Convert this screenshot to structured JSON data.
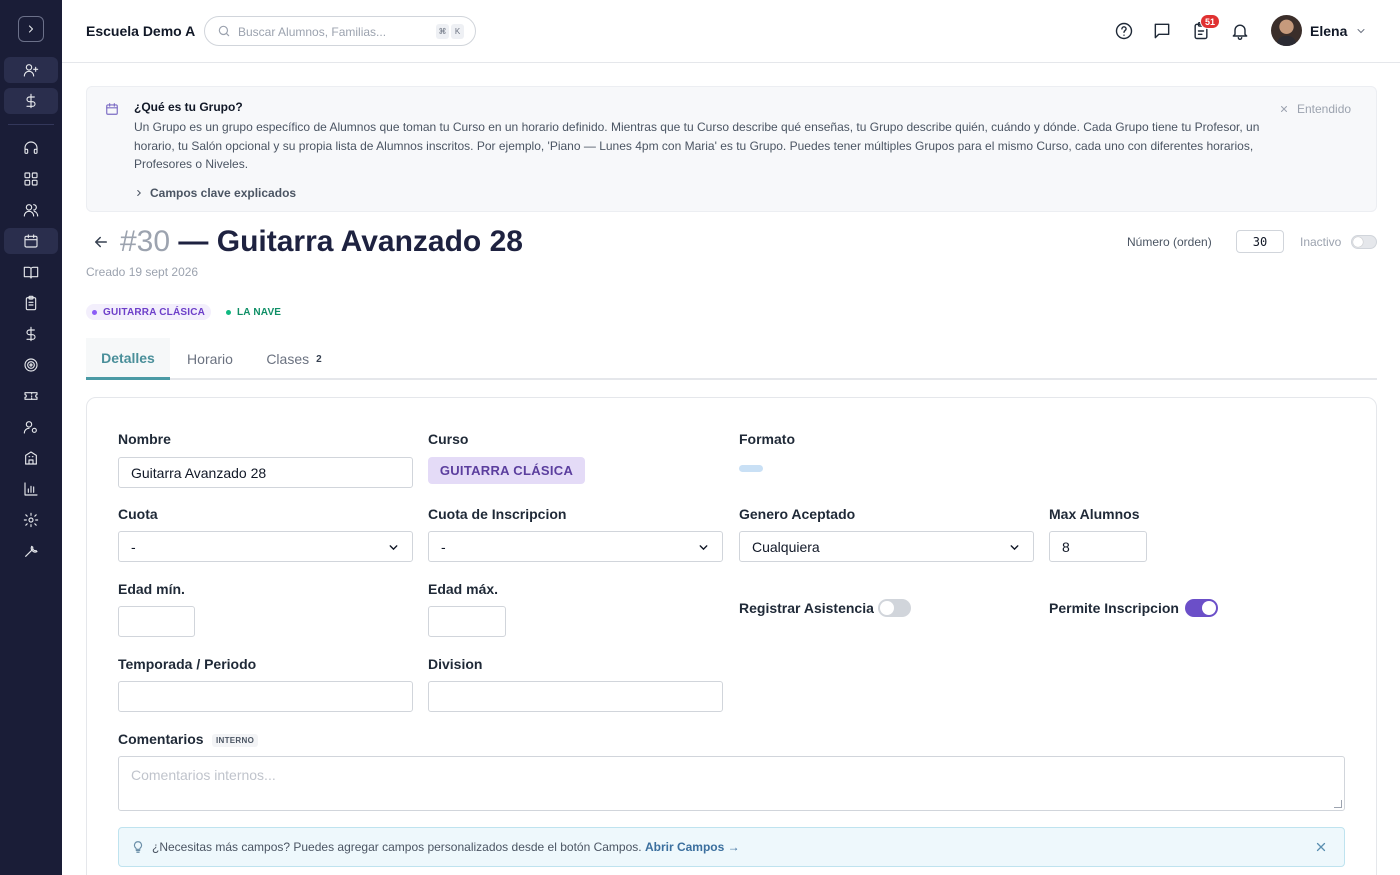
{
  "header": {
    "school_name": "Escuela Demo A",
    "search_placeholder": "Buscar Alumnos, Familias...",
    "search_kbd": [
      "⌘",
      "K"
    ],
    "notification_count": "51",
    "user_name": "Elena"
  },
  "sidebar": {
    "items": [
      {
        "icon": "user-plus-icon"
      },
      {
        "icon": "dollar-icon"
      },
      {
        "icon": "headset-icon"
      },
      {
        "icon": "grid-icon"
      },
      {
        "icon": "users-icon"
      },
      {
        "icon": "calendar-icon"
      },
      {
        "icon": "book-icon"
      },
      {
        "icon": "clipboard-icon"
      },
      {
        "icon": "dollar-icon"
      },
      {
        "icon": "target-icon"
      },
      {
        "icon": "ticket-icon"
      },
      {
        "icon": "user-settings-icon"
      },
      {
        "icon": "building-icon"
      },
      {
        "icon": "chart-icon"
      },
      {
        "icon": "gear-icon"
      },
      {
        "icon": "wrench-icon"
      }
    ]
  },
  "banner": {
    "title": "¿Qué es tu Grupo?",
    "text": "Un Grupo es un grupo específico de Alumnos que toman tu Curso en un horario definido. Mientras que tu Curso describe qué enseñas, tu Grupo describe quién, cuándo y dónde. Cada Grupo tiene tu Profesor, un horario, tu Salón opcional y su propia lista de Alumnos inscritos. Por ejemplo, 'Piano — Lunes 4pm con Maria' es tu Grupo. Puedes tener múltiples Grupos para el mismo Curso, cada uno con diferentes horarios, Profesores o Niveles.",
    "more_label": "Campos clave explicados",
    "dismiss_label": "Entendido"
  },
  "group": {
    "number": "#30",
    "title": "— Guitarra Avanzado 28",
    "created": "Creado 19 sept 2026",
    "order_label": "Número (orden)",
    "order_value": "30",
    "inactive_label": "Inactivo",
    "tags": [
      {
        "label": "GUITARRA CLÁSICA",
        "color": "#7c3aed"
      },
      {
        "label": "LA NAVE",
        "color": "#0f9f6e"
      }
    ]
  },
  "tabs": [
    {
      "label": "Detalles",
      "active": true
    },
    {
      "label": "Horario"
    },
    {
      "label": "Clases",
      "count": "2"
    }
  ],
  "form": {
    "nombre": {
      "label": "Nombre",
      "value": "Guitarra Avanzado 28"
    },
    "curso": {
      "label": "Curso",
      "value": "GUITARRA CLÁSICA"
    },
    "formato": {
      "label": "Formato"
    },
    "cuota": {
      "label": "Cuota",
      "value": "-"
    },
    "cuota_inscripcion": {
      "label": "Cuota de Inscripcion",
      "value": "-"
    },
    "genero": {
      "label": "Genero Aceptado",
      "value": "Cualquiera"
    },
    "max_alumnos": {
      "label": "Max Alumnos",
      "value": "8"
    },
    "edad_min": {
      "label": "Edad mín.",
      "value": ""
    },
    "edad_max": {
      "label": "Edad máx.",
      "value": ""
    },
    "registrar_asistencia": {
      "label": "Registrar Asistencia",
      "on": false
    },
    "permite_inscripcion": {
      "label": "Permite Inscripcion",
      "on": true
    },
    "temporada": {
      "label": "Temporada / Periodo",
      "value": ""
    },
    "division": {
      "label": "Division",
      "value": ""
    },
    "comentarios": {
      "label": "Comentarios",
      "badge": "INTERNO",
      "placeholder": "Comentarios internos..."
    }
  },
  "tip": {
    "text": "¿Necesitas más campos? Puedes agregar campos personalizados desde el botón Campos.",
    "link": "Abrir Campos →"
  },
  "colors": {
    "sidebar_bg": "#1a1d37",
    "accent_teal": "#4a9aa5",
    "accent_purple": "#6b4fc8"
  }
}
